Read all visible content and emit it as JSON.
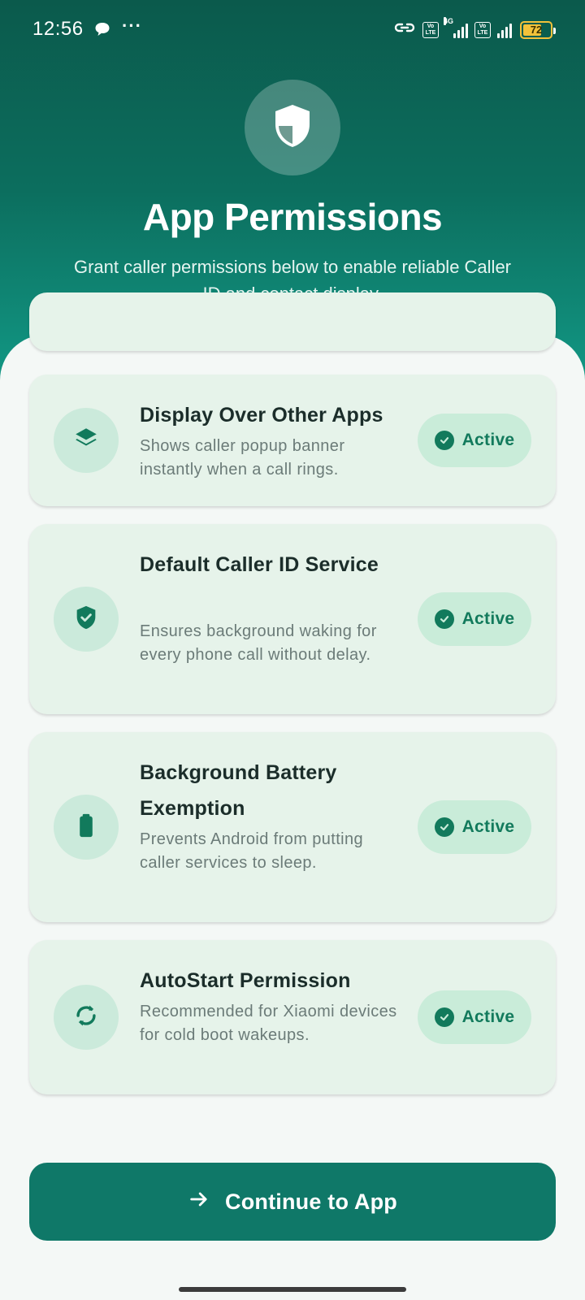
{
  "status_bar": {
    "time": "12:56",
    "dots": "···",
    "volte_top": "Vo",
    "volte_bottom": "LTE",
    "network": "4G",
    "battery": "72",
    "battery_fraction": 0.72,
    "battery_color": "#f3c23a"
  },
  "header": {
    "icon": "shield-icon",
    "title": "App Permissions",
    "subtitle": "Grant caller permissions below to enable reliable Caller ID and contact display."
  },
  "permissions": [
    {
      "icon": "layers-icon",
      "title": "Display Over Other Apps",
      "description": "Shows caller popup banner instantly when a call rings.",
      "status": "Active"
    },
    {
      "icon": "shield-check-icon",
      "title": "Default Caller ID Service",
      "description": "Ensures background waking for every phone call without delay.",
      "status": "Active"
    },
    {
      "icon": "battery-icon",
      "title": "Background Battery Exemption",
      "description": "Prevents Android from putting caller services to sleep.",
      "status": "Active"
    },
    {
      "icon": "autorenew-icon",
      "title": "AutoStart Permission",
      "description": "Recommended for Xiaomi devices for cold boot wakeups.",
      "status": "Active"
    }
  ],
  "continue_button": {
    "icon": "arrow-right-icon",
    "label": "Continue to App"
  },
  "colors": {
    "header_gradient_top": "#0b5a4c",
    "header_gradient_bottom": "#13a08c",
    "accent": "#127a5c",
    "card_background": "#e6f3ea",
    "badge_background": "#c9ecd9",
    "button_background": "#0f7868"
  }
}
